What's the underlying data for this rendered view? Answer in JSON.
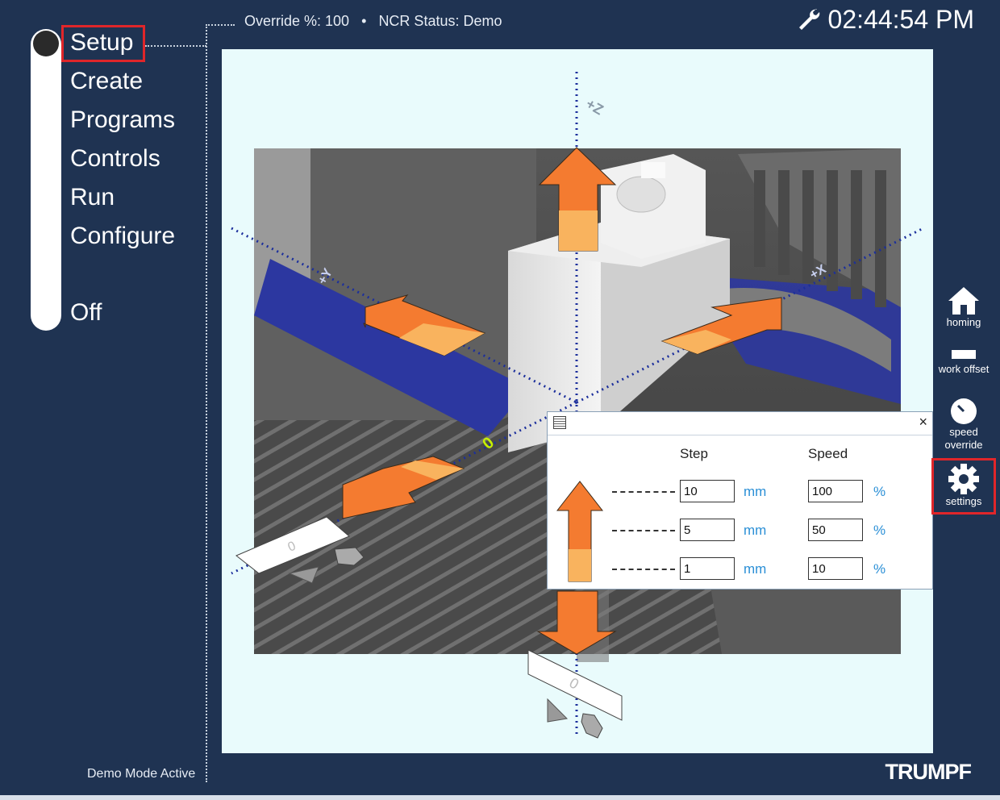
{
  "header": {
    "override_text": "Override %: 100",
    "separator": "•",
    "ncr_status_text": "NCR Status: Demo",
    "clock_icon": "wrench-icon",
    "time": "02:44:54 PM"
  },
  "sidebar": {
    "items": [
      {
        "label": "Setup",
        "active": true
      },
      {
        "label": "Create"
      },
      {
        "label": "Programs"
      },
      {
        "label": "Controls"
      },
      {
        "label": "Run"
      },
      {
        "label": "Configure"
      },
      {
        "label": "Off"
      }
    ],
    "footer_status": "Demo Mode Active"
  },
  "scene": {
    "axis_labels": {
      "z": "+Z",
      "y": "+Y",
      "x": "+X"
    },
    "origin_label": "0",
    "bottom_marker_label": "0",
    "left_marker_label": "0"
  },
  "toolbar": {
    "items": [
      {
        "label": "homing",
        "icon": "home-icon"
      },
      {
        "label": "work offset",
        "icon": "work-offset-icon"
      },
      {
        "label": "speed override",
        "icon": "speed-gauge-icon"
      },
      {
        "label": "settings",
        "icon": "gear-icon",
        "highlighted": true
      }
    ]
  },
  "jog_dialog": {
    "close_label": "×",
    "step_header": "Step",
    "speed_header": "Speed",
    "rows": [
      {
        "step": "10",
        "step_unit": "mm",
        "speed": "100",
        "speed_unit": "%"
      },
      {
        "step": "5",
        "step_unit": "mm",
        "speed": "50",
        "speed_unit": "%"
      },
      {
        "step": "1",
        "step_unit": "mm",
        "speed": "10",
        "speed_unit": "%"
      }
    ]
  },
  "brand": "TRUMPF",
  "colors": {
    "background": "#1f3352",
    "highlight": "#e0262a",
    "arrow_orange": "#f47b30",
    "arrow_light": "#f9b35e",
    "unit_blue": "#2a8fd6",
    "axis_blue": "#1c2f9c"
  }
}
